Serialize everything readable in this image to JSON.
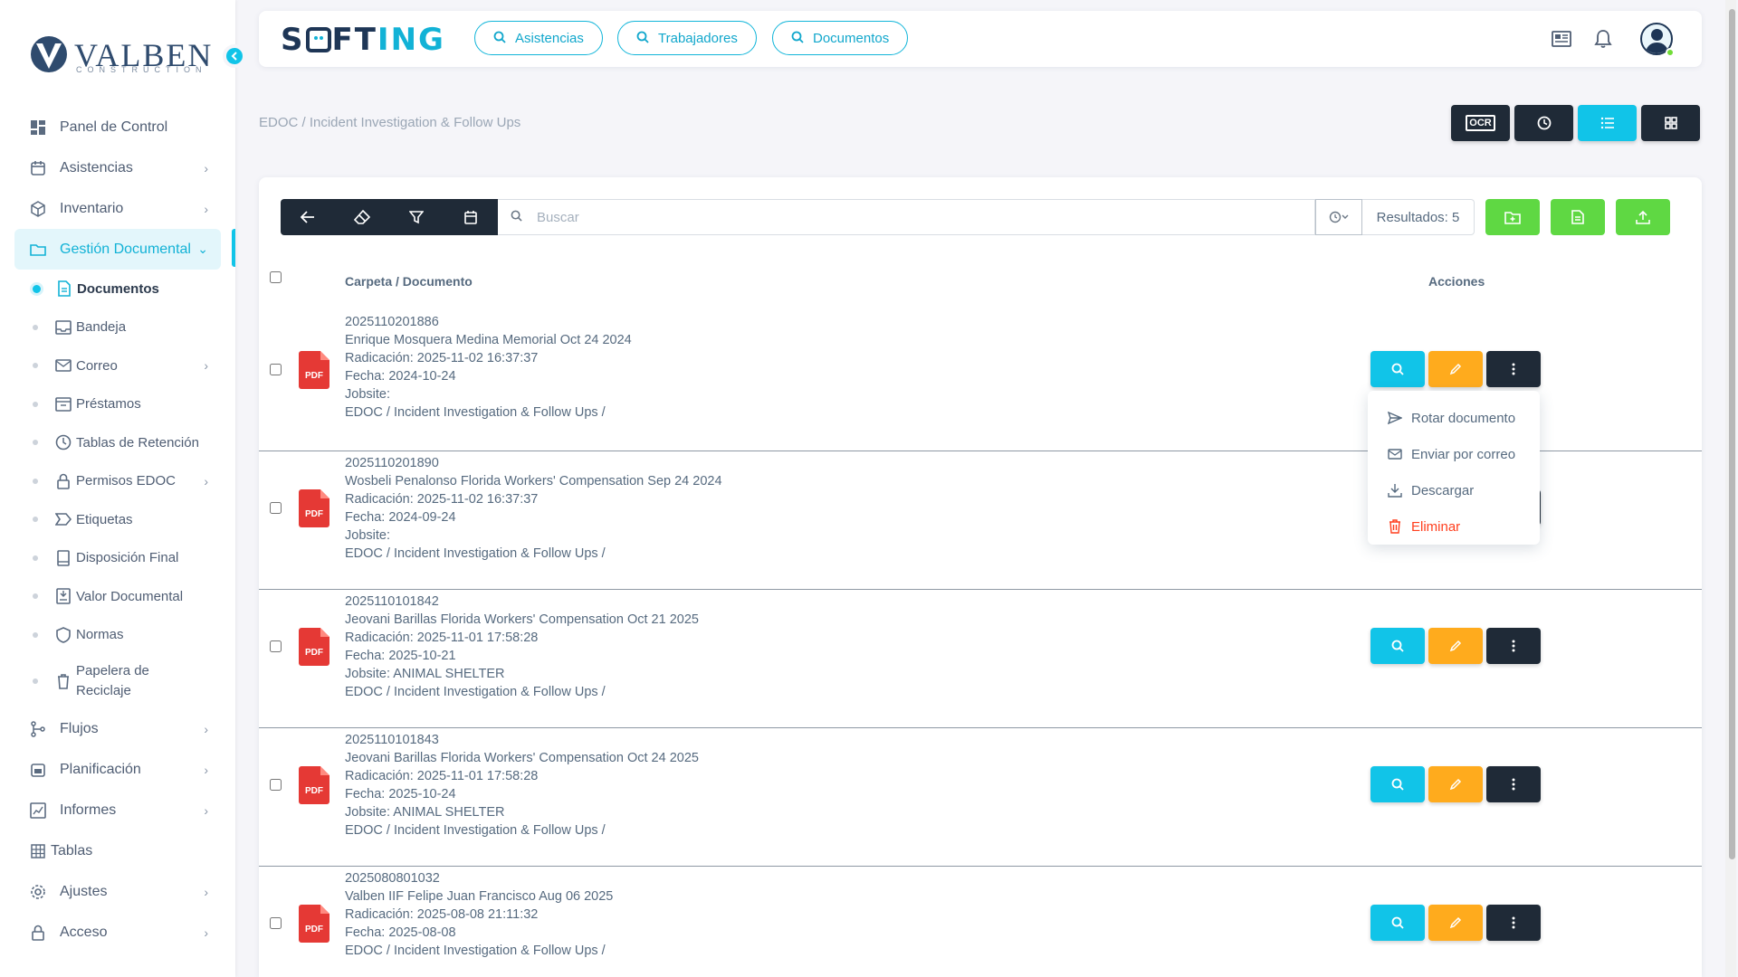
{
  "brand": {
    "company": "VALBEN",
    "company_sub": "CONSTRUCTION",
    "app": "S",
    "app_mid": "FT",
    "app_end": "ING"
  },
  "quick_links": [
    {
      "label": "Asistencias",
      "icon": "search-icon"
    },
    {
      "label": "Trabajadores",
      "icon": "search-icon"
    },
    {
      "label": "Documentos",
      "icon": "search-icon"
    }
  ],
  "sidebar": {
    "items": [
      {
        "label": "Panel de Control",
        "icon": "dashboard-icon",
        "chevron": false
      },
      {
        "label": "Asistencias",
        "icon": "calendar-icon",
        "chevron": true
      },
      {
        "label": "Inventario",
        "icon": "box-icon",
        "chevron": true
      },
      {
        "label": "Gestión Documental",
        "icon": "folder-icon",
        "chevron": true,
        "active": true
      }
    ],
    "sub_items": [
      {
        "label": "Documentos",
        "icon": "file-icon",
        "active": true
      },
      {
        "label": "Bandeja",
        "icon": "inbox-icon"
      },
      {
        "label": "Correo",
        "icon": "mail-icon",
        "chevron": true
      },
      {
        "label": "Préstamos",
        "icon": "archive-icon"
      },
      {
        "label": "Tablas de Retención",
        "icon": "clock-icon"
      },
      {
        "label": "Permisos EDOC",
        "icon": "lock-icon",
        "chevron": true
      },
      {
        "label": "Etiquetas",
        "icon": "tag-icon"
      },
      {
        "label": "Disposición Final",
        "icon": "book-icon"
      },
      {
        "label": "Valor Documental",
        "icon": "download-box-icon"
      },
      {
        "label": "Normas",
        "icon": "shield-icon"
      },
      {
        "label": "Papelera de Reciclaje",
        "icon": "trash-icon"
      }
    ],
    "bottom_items": [
      {
        "label": "Flujos",
        "icon": "flow-icon",
        "chevron": true
      },
      {
        "label": "Planificación",
        "icon": "calendar-check-icon",
        "chevron": true
      },
      {
        "label": "Informes",
        "icon": "report-icon",
        "chevron": true
      },
      {
        "label": "Tablas",
        "icon": "table-icon",
        "chevron": false
      },
      {
        "label": "Ajustes",
        "icon": "gear-icon",
        "chevron": true
      },
      {
        "label": "Acceso",
        "icon": "lock-icon",
        "chevron": true
      }
    ]
  },
  "breadcrumb": "EDOC / Incident Investigation & Follow Ups",
  "view_buttons": [
    {
      "label": "OCR",
      "icon": "ocr-icon"
    },
    {
      "label": "",
      "icon": "history-icon"
    },
    {
      "label": "",
      "icon": "list-icon",
      "active": true
    },
    {
      "label": "",
      "icon": "grid-icon"
    }
  ],
  "search": {
    "placeholder": "Buscar",
    "results_label": "Resultados: 5"
  },
  "table": {
    "col_name": "Carpeta / Documento",
    "col_actions": "Acciones",
    "rows": [
      {
        "code": "2025110201886",
        "title": "Enrique Mosquera Medina Memorial Oct 24 2024",
        "radicacion": "Radicación: 2025-11-02 16:37:37",
        "fecha": "Fecha: 2024-10-24",
        "jobsite": "Jobsite:",
        "path": "EDOC / Incident Investigation & Follow Ups /"
      },
      {
        "code": "2025110201890",
        "title": "Wosbeli Penalonso Florida Workers' Compensation Sep 24 2024",
        "radicacion": "Radicación: 2025-11-02 16:37:37",
        "fecha": "Fecha: 2024-09-24",
        "jobsite": "Jobsite:",
        "path": "EDOC / Incident Investigation & Follow Ups /"
      },
      {
        "code": "2025110101842",
        "title": "Jeovani Barillas Florida Workers' Compensation Oct 21 2025",
        "radicacion": "Radicación: 2025-11-01 17:58:28",
        "fecha": "Fecha: 2025-10-21",
        "jobsite": "Jobsite: ANIMAL SHELTER",
        "path": "EDOC / Incident Investigation & Follow Ups /"
      },
      {
        "code": "2025110101843",
        "title": "Jeovani Barillas Florida Workers' Compensation Oct 24 2025",
        "radicacion": "Radicación: 2025-11-01 17:58:28",
        "fecha": "Fecha: 2025-10-24",
        "jobsite": "Jobsite: ANIMAL SHELTER",
        "path": "EDOC / Incident Investigation & Follow Ups /"
      },
      {
        "code": "2025080801032",
        "title": "Valben IIF Felipe Juan Francisco Aug 06 2025",
        "radicacion": "Radicación: 2025-08-08 21:11:32",
        "fecha": "Fecha: 2025-08-08",
        "path": "EDOC / Incident Investigation & Follow Ups /"
      }
    ]
  },
  "dropdown": [
    {
      "label": "Rotar documento",
      "icon": "send-icon"
    },
    {
      "label": "Enviar por correo",
      "icon": "mail-icon"
    },
    {
      "label": "Descargar",
      "icon": "download-icon"
    },
    {
      "label": "Eliminar",
      "icon": "trash-icon",
      "danger": true
    }
  ],
  "pdf_label": "PDF",
  "colors": {
    "accent": "#11c4e8",
    "dark": "#1f2a37",
    "orange": "#ffab1d",
    "green": "#5fd843",
    "danger": "#ff3e1d"
  }
}
